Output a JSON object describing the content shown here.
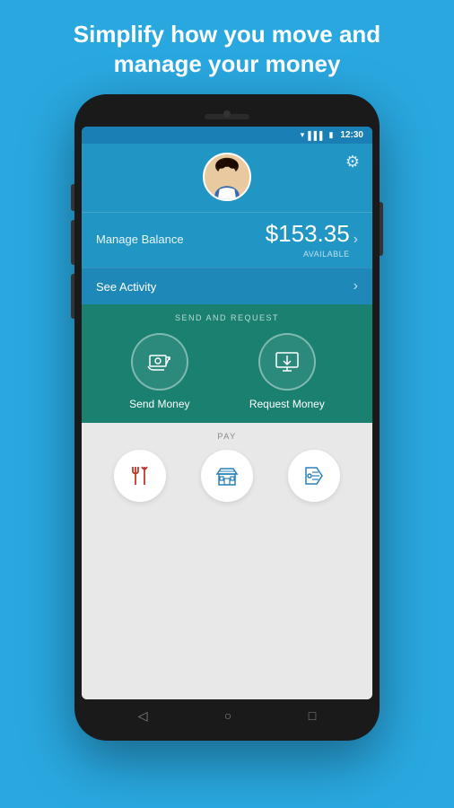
{
  "page": {
    "tagline": "Simplify how you move and manage your money"
  },
  "status_bar": {
    "time": "12:30"
  },
  "header": {
    "settings_icon": "⚙"
  },
  "balance": {
    "manage_label": "Manage Balance",
    "amount": "$153.35",
    "available_label": "AVAILABLE"
  },
  "activity": {
    "label": "See Activity"
  },
  "send_request": {
    "section_title": "SEND AND REQUEST",
    "send_label": "Send Money",
    "request_label": "Request Money"
  },
  "pay": {
    "section_title": "PAY",
    "restaurant_label": "",
    "store_label": "",
    "ticket_label": ""
  },
  "nav": {
    "back": "◁",
    "home": "○",
    "recent": "□"
  }
}
